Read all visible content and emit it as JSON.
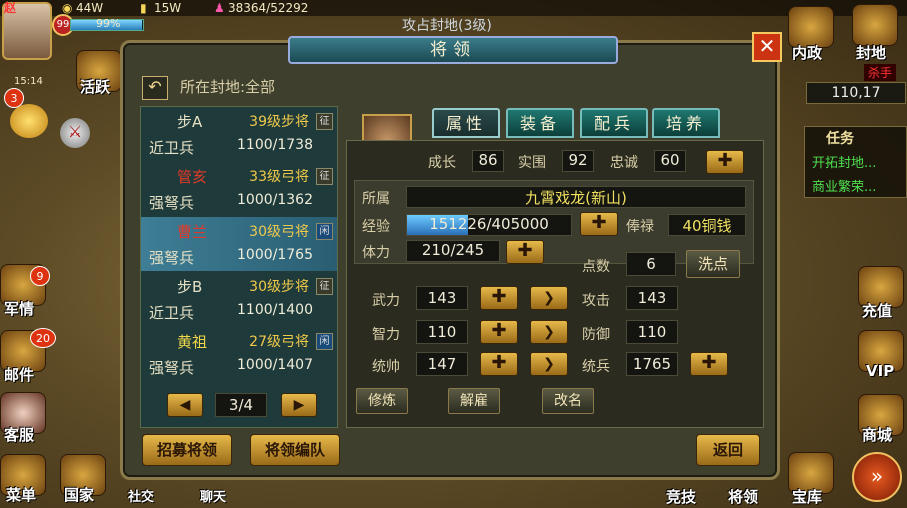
{
  "hud": {
    "player_initial": "赵",
    "level": "99",
    "exp_percent": "99%",
    "gold": "44W",
    "grain": "15W",
    "power": "38364/52292",
    "time": "15:14",
    "banner": "攻占封地(3级)"
  },
  "left_side": {
    "huoyue": "活跃",
    "yuanbao_badge": "3",
    "junqing": "军情",
    "junqing_badge": "9",
    "youjian": "邮件",
    "youjian_badge": "20",
    "kefu": "客服",
    "caidan": "菜单",
    "guojia": "国家",
    "shejiao": "社交",
    "liaotian": "聊天"
  },
  "right_side": {
    "neizheng": "内政",
    "fengdi": "封地",
    "shajian": "杀手",
    "coords": "110,17",
    "task_title": "任务",
    "task1": "开拓封地...",
    "task2": "商业繁荣...",
    "chongzhi": "充值",
    "vip": "VIP",
    "shangcheng": "商城",
    "jingji": "竞技",
    "jiangling": "将领",
    "baoku": "宝库"
  },
  "dialog": {
    "title": "将领",
    "close": "✕",
    "location": "所在封地:全部",
    "rows": [
      {
        "name": "步A",
        "rank": "39级步将",
        "corner": "征",
        "troop": "近卫兵",
        "count": "1100/1738",
        "name_color": "#e6e0c4",
        "rank_color": "#f0c84a"
      },
      {
        "name": "管亥",
        "rank": "33级弓将",
        "corner": "征",
        "troop": "强弩兵",
        "count": "1000/1362",
        "name_color": "#e23a2a",
        "rank_color": "#f0c84a"
      },
      {
        "name": "曹兰",
        "rank": "30级弓将",
        "corner": "闲",
        "troop": "强弩兵",
        "count": "1000/1765",
        "name_color": "#e23a2a",
        "rank_color": "#f0c84a"
      },
      {
        "name": "步B",
        "rank": "30级步将",
        "corner": "征",
        "troop": "近卫兵",
        "count": "1100/1400",
        "name_color": "#e6e0c4",
        "rank_color": "#f0c84a"
      },
      {
        "name": "黄祖",
        "rank": "27级弓将",
        "corner": "闲",
        "troop": "强弩兵",
        "count": "1000/1407",
        "name_color": "#f0d84a",
        "rank_color": "#f0c84a"
      }
    ],
    "page": "3/4",
    "tabs": [
      "属性",
      "装备",
      "配兵",
      "培养"
    ],
    "growth_label": "成长",
    "growth": "86",
    "shiwei_label": "实围",
    "shiwei": "92",
    "loyalty_label": "忠诚",
    "loyalty": "60",
    "belong_label": "所属",
    "belong": "九霄戏龙(新山)",
    "exp_label": "经验",
    "exp": "151226/405000",
    "exp_fraction": 0.373,
    "salary_label": "俸禄",
    "salary": "40铜钱",
    "stamina_label": "体力",
    "stamina": "210/245",
    "points_label": "点数",
    "points": "6",
    "reset": "洗点",
    "stats": [
      {
        "label": "武力",
        "value": "143",
        "label2": "攻击",
        "value2": "143"
      },
      {
        "label": "智力",
        "value": "110",
        "label2": "防御",
        "value2": "110"
      },
      {
        "label": "统帅",
        "value": "147",
        "label2": "统兵",
        "value2": "1765"
      }
    ],
    "train": "修炼",
    "dismiss": "解雇",
    "rename": "改名",
    "recruit": "招募将领",
    "formation": "将领编队",
    "return": "返回"
  }
}
